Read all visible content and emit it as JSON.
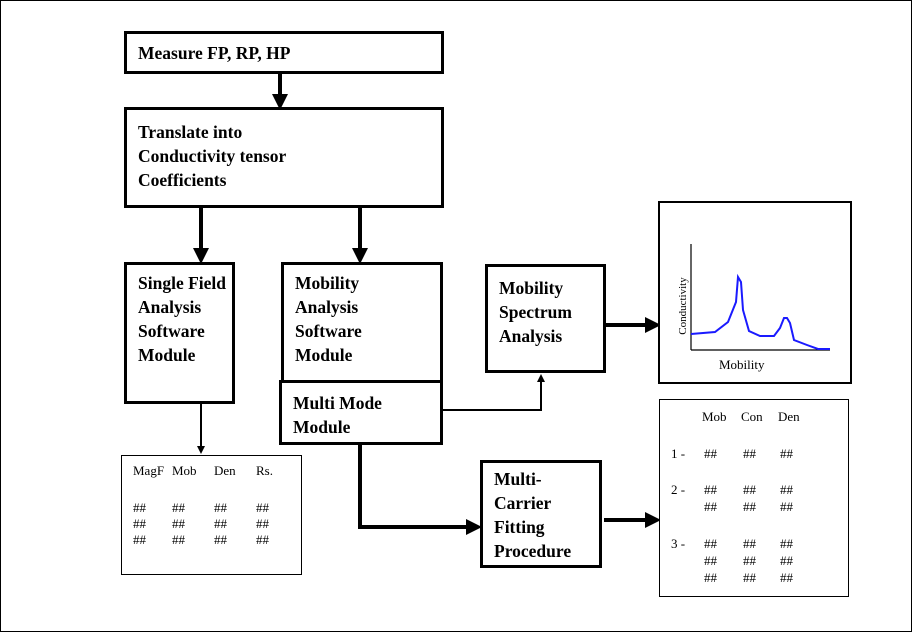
{
  "boxes": {
    "measure": {
      "lines": [
        "Measure FP, RP, HP"
      ]
    },
    "translate": {
      "lines": [
        "Translate into",
        "Conductivity tensor",
        "Coefficients"
      ]
    },
    "single_field": {
      "lines": [
        "Single Field",
        "Analysis",
        "Software",
        "Module"
      ]
    },
    "mobility_analysis": {
      "lines": [
        "Mobility",
        "Analysis",
        "Software",
        "Module"
      ]
    },
    "multi_mode": {
      "lines": [
        "Multi Mode",
        "Module"
      ]
    },
    "mobility_spectrum": {
      "lines": [
        "Mobility",
        "Spectrum",
        "Analysis"
      ]
    },
    "multi_carrier": {
      "lines": [
        "Multi-",
        "Carrier",
        "Fitting",
        "Procedure"
      ]
    }
  },
  "spectrum_chart": {
    "ylabel": "Conductivity",
    "xlabel": "Mobility",
    "line_color": "#1a1aff"
  },
  "single_field_table": {
    "headers": [
      "MagF",
      "Mob",
      "Den",
      "Rs."
    ],
    "rows": [
      [
        "##",
        "##",
        "##",
        "##"
      ],
      [
        "##",
        "##",
        "##",
        "##"
      ],
      [
        "##",
        "##",
        "##",
        "##"
      ]
    ]
  },
  "multi_carrier_table": {
    "headers": [
      "Mob",
      "Con",
      "Den"
    ],
    "groups": [
      {
        "label": "1 -",
        "rows": [
          [
            "##",
            "##",
            "##"
          ]
        ]
      },
      {
        "label": "2 -",
        "rows": [
          [
            "##",
            "##",
            "##"
          ],
          [
            "##",
            "##",
            "##"
          ]
        ]
      },
      {
        "label": "3 -",
        "rows": [
          [
            "##",
            "##",
            "##"
          ],
          [
            "##",
            "##",
            "##"
          ],
          [
            "##",
            "##",
            "##"
          ]
        ]
      }
    ]
  }
}
